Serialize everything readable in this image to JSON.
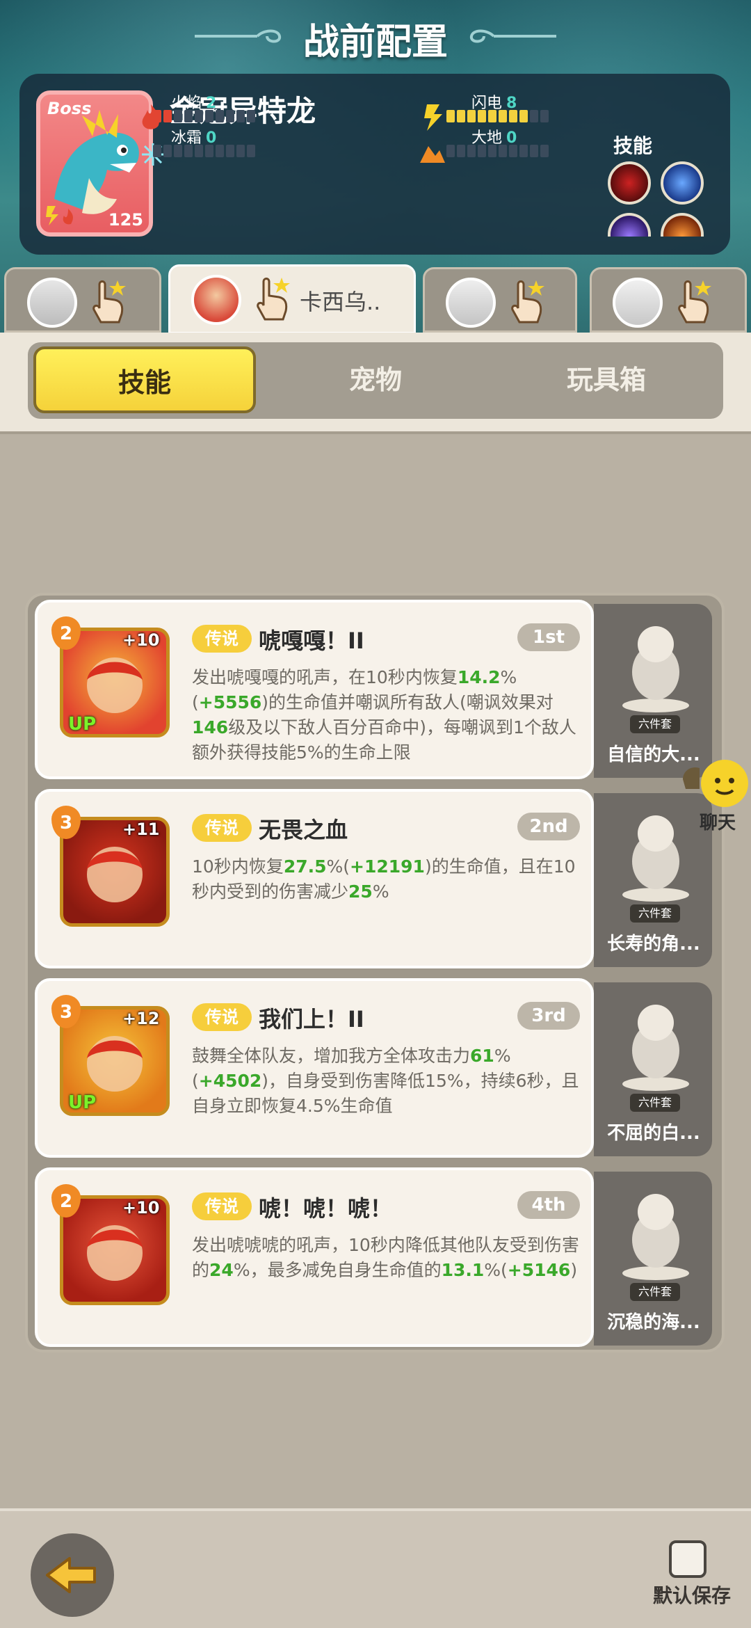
{
  "header": {
    "title": "战前配置"
  },
  "boss": {
    "tag": "Boss",
    "name": "金冠异特龙",
    "level": "125",
    "elements": [
      {
        "name": "火焰",
        "value": "2"
      },
      {
        "name": "闪电",
        "value": "8"
      },
      {
        "name": "冰霜",
        "value": "0"
      },
      {
        "name": "大地",
        "value": "0"
      }
    ],
    "skills_label": "技能"
  },
  "team": {
    "active_name": "卡西乌.."
  },
  "tabs": [
    "技能",
    "宠物",
    "玩具箱"
  ],
  "skills": [
    {
      "rarity": "传说",
      "name": "唬嘎嘎！II",
      "rank": "1st",
      "level": "2",
      "plus": "+10",
      "up": "UP",
      "desc": [
        {
          "t": "发出唬嘎嘎的吼声，在10秒内恢复"
        },
        {
          "t": "14.2",
          "g": true
        },
        {
          "t": "%("
        },
        {
          "t": "+5556",
          "g": true
        },
        {
          "t": ")的生命值并嘲讽所有敌人(嘲讽效果对"
        },
        {
          "t": "146",
          "g": true
        },
        {
          "t": "级及以下敌人百分百命中)，每嘲讽到1个敌人额外获得技能5%的生命上限"
        }
      ],
      "pet": {
        "tag": "六件套",
        "name": "自信的大..."
      }
    },
    {
      "rarity": "传说",
      "name": "无畏之血",
      "rank": "2nd",
      "level": "3",
      "plus": "+11",
      "up": "",
      "desc": [
        {
          "t": "10秒内恢复"
        },
        {
          "t": "27.5",
          "g": true
        },
        {
          "t": "%("
        },
        {
          "t": "+12191",
          "g": true
        },
        {
          "t": ")的生命值，且在10秒内受到的伤害减少"
        },
        {
          "t": "25",
          "g": true
        },
        {
          "t": "%"
        }
      ],
      "pet": {
        "tag": "六件套",
        "name": "长寿的角..."
      }
    },
    {
      "rarity": "传说",
      "name": "我们上！II",
      "rank": "3rd",
      "level": "3",
      "plus": "+12",
      "up": "UP",
      "desc": [
        {
          "t": "鼓舞全体队友，增加我方全体攻击力"
        },
        {
          "t": "61",
          "g": true
        },
        {
          "t": "%("
        },
        {
          "t": "+4502",
          "g": true
        },
        {
          "t": ")，自身受到伤害降低15%，持续6秒，且自身立即恢复4.5%生命值"
        }
      ],
      "pet": {
        "tag": "六件套",
        "name": "不屈的白..."
      }
    },
    {
      "rarity": "传说",
      "name": "唬！唬！唬！",
      "rank": "4th",
      "level": "2",
      "plus": "+10",
      "up": "",
      "desc": [
        {
          "t": "发出唬唬唬的吼声，10秒内降低其他队友受到伤害的"
        },
        {
          "t": "24",
          "g": true
        },
        {
          "t": "%，最多减免自身生命值的"
        },
        {
          "t": "13.1",
          "g": true
        },
        {
          "t": "%("
        },
        {
          "t": "+5146",
          "g": true
        },
        {
          "t": ")"
        }
      ],
      "pet": {
        "tag": "六件套",
        "name": "沉稳的海..."
      }
    }
  ],
  "chat": {
    "label": "聊天"
  },
  "footer": {
    "default_save": "默认保存"
  }
}
